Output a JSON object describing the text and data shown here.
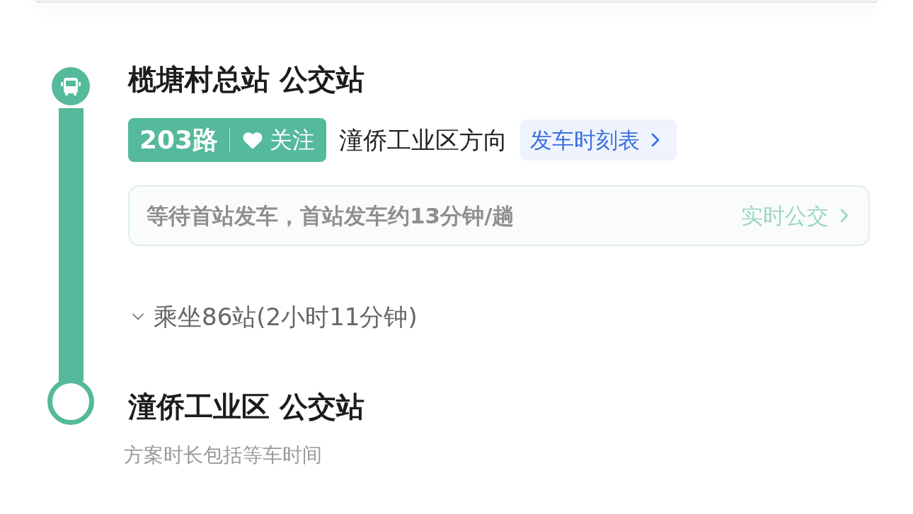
{
  "origin": {
    "name": "榄塘村总站 公交站"
  },
  "line": {
    "name": "203路",
    "follow_label": "关注"
  },
  "direction": "潼侨工业区方向",
  "timetable_link": "发车时刻表",
  "notice": {
    "text": "等待首站发车，首站发车约13分钟/趟",
    "link": "实时公交"
  },
  "ride": {
    "summary": "乘坐86站(2小时11分钟)",
    "expanded": false
  },
  "destination": {
    "name": "潼侨工业区 公交站"
  },
  "footnote": "方案时长包括等车时间"
}
